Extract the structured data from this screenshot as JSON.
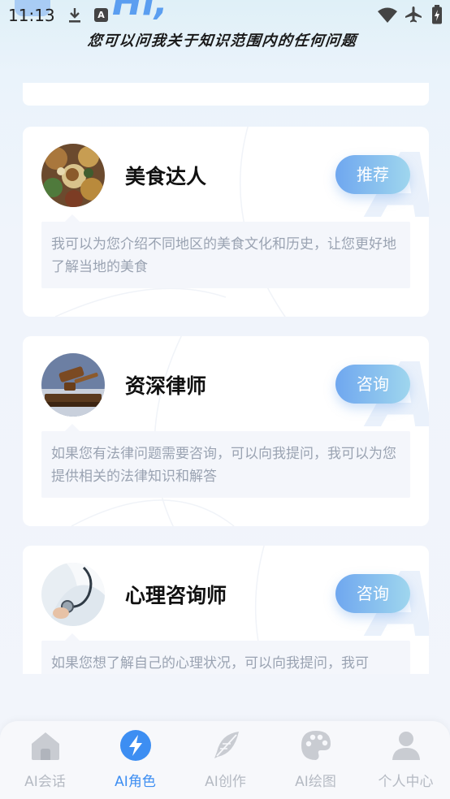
{
  "status_bar": {
    "time": "11:13",
    "icons": [
      "download-icon",
      "a-notification-icon",
      "wifi-icon",
      "airplane-icon",
      "battery-icon"
    ],
    "a_badge": "A"
  },
  "header": {
    "greeting": "Hi,",
    "subtitle": "您可以问我关于知识范围内的任何问题"
  },
  "roles": [
    {
      "name": "美食达人",
      "tag": "推荐",
      "description": "我可以为您介绍不同地区的美食文化和历史，让您更好地了解当地的美食",
      "avatar": "food-avatar"
    },
    {
      "name": "资深律师",
      "tag": "咨询",
      "description": "如果您有法律问题需要咨询，可以向我提问，我可以为您提供相关的法律知识和解答",
      "avatar": "gavel-avatar"
    },
    {
      "name": "心理咨询师",
      "tag": "咨询",
      "description": "如果您想了解自己的心理状况，可以向我提问，我可",
      "avatar": "stethoscope-avatar"
    }
  ],
  "watermark": "A",
  "bottom_nav": [
    {
      "label": "AI会话",
      "icon": "home-icon",
      "active": false
    },
    {
      "label": "AI角色",
      "icon": "lightning-icon",
      "active": true
    },
    {
      "label": "AI创作",
      "icon": "feather-icon",
      "active": false
    },
    {
      "label": "AI绘图",
      "icon": "palette-icon",
      "active": false
    },
    {
      "label": "个人中心",
      "icon": "user-icon",
      "active": false
    }
  ],
  "colors": {
    "accent": "#3d8ef2",
    "tag_gradient_start": "#6fa7ef",
    "tag_gradient_end": "#9fd6ee",
    "nav_inactive": "#b5bac3",
    "desc_text": "#9aa3b2"
  }
}
